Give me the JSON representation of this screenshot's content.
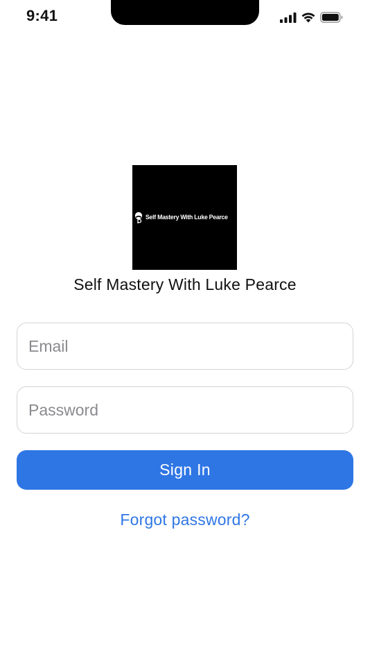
{
  "status_bar": {
    "time": "9:41",
    "icons": [
      "cellular-signal-icon",
      "wifi-icon",
      "battery-icon"
    ]
  },
  "app": {
    "logo_text": "Self Mastery With Luke Pearce",
    "title": "Self Mastery With Luke Pearce"
  },
  "form": {
    "email_placeholder": "Email",
    "email_value": "",
    "password_placeholder": "Password",
    "password_value": "",
    "sign_in_label": "Sign In",
    "forgot_password_label": "Forgot password?"
  },
  "colors": {
    "accent": "#2f76e5",
    "background": "#ffffff",
    "logo_background": "#000000"
  }
}
